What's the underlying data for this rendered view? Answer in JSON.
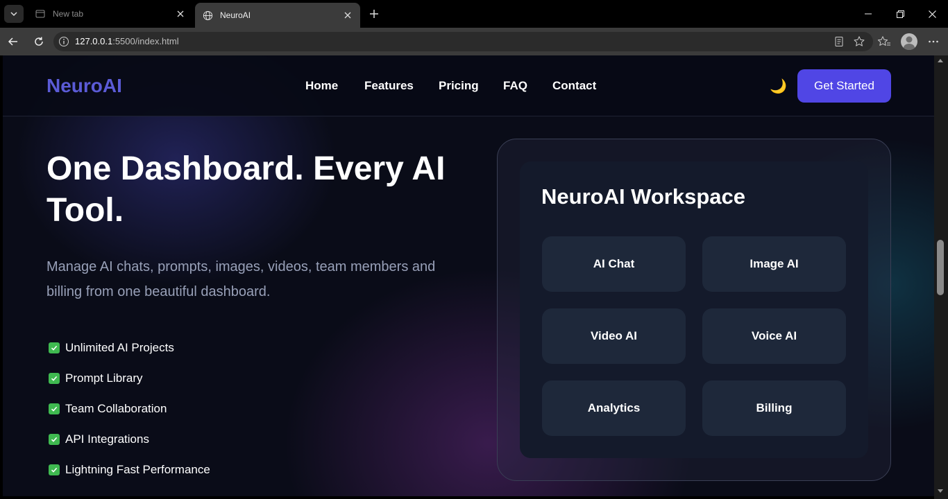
{
  "browser": {
    "tabs": [
      {
        "title": "New tab"
      },
      {
        "title": "NeuroAI"
      }
    ],
    "url_host": "127.0.0.1",
    "url_rest": ":5500/index.html"
  },
  "nav": {
    "logo": "NeuroAI",
    "links": [
      "Home",
      "Features",
      "Pricing",
      "FAQ",
      "Contact"
    ],
    "theme_icon": "🌙",
    "cta_label": "Get Started"
  },
  "hero": {
    "title": "One Dashboard. Every AI Tool.",
    "subtitle": "Manage AI chats, prompts, images, videos, team members and billing from one beautiful dashboard.",
    "features": [
      "Unlimited AI Projects",
      "Prompt Library",
      "Team Collaboration",
      "API Integrations",
      "Lightning Fast Performance"
    ]
  },
  "workspace": {
    "title": "NeuroAI Workspace",
    "tools": [
      "AI Chat",
      "Image AI",
      "Video AI",
      "Voice AI",
      "Analytics",
      "Billing"
    ]
  },
  "colors": {
    "accent": "#5046e5",
    "logo": "#5b5bd6",
    "check": "#3fb950"
  }
}
